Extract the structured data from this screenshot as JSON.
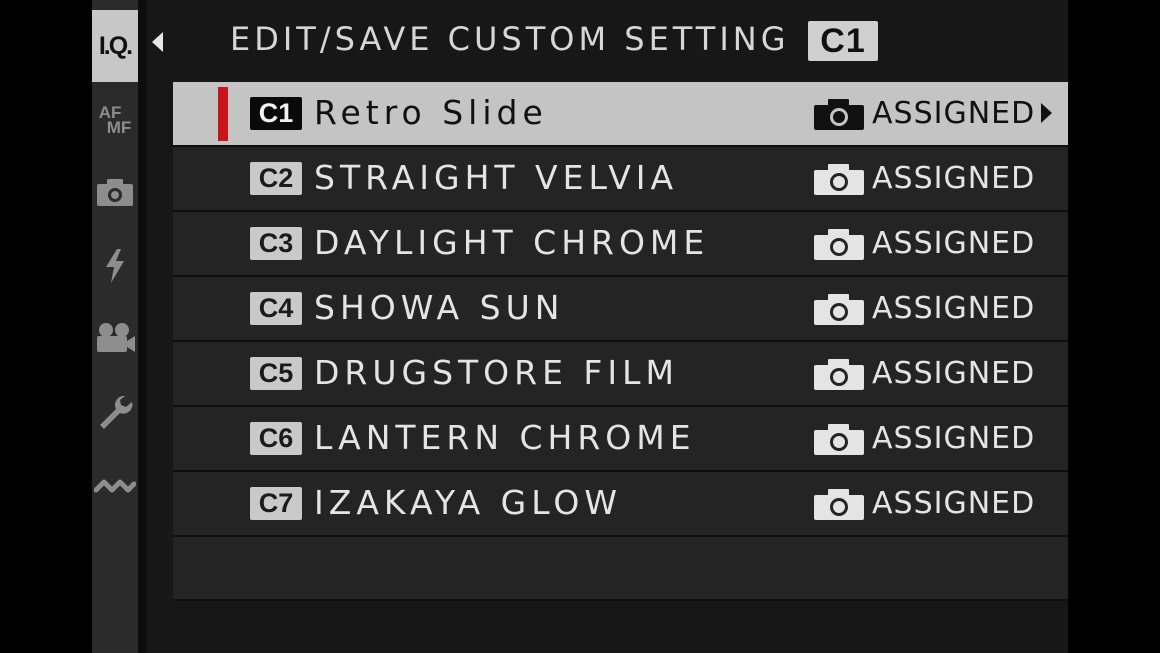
{
  "header": {
    "title": "EDIT/SAVE CUSTOM SETTING",
    "badge": "C1"
  },
  "sidebar": {
    "active_label": "I.Q.",
    "afmf_label_top": "AF",
    "afmf_label_bottom": "MF",
    "icons": [
      "iq-icon",
      "af-mf-icon",
      "camera-icon",
      "flash-icon",
      "movie-icon",
      "wrench-icon",
      "connection-icon"
    ]
  },
  "settings": [
    {
      "badge": "C1",
      "name": "Retro Slide",
      "status": "ASSIGNED",
      "selected": true
    },
    {
      "badge": "C2",
      "name": "STRAIGHT VELVIA",
      "status": "ASSIGNED",
      "selected": false
    },
    {
      "badge": "C3",
      "name": "DAYLIGHT CHROME",
      "status": "ASSIGNED",
      "selected": false
    },
    {
      "badge": "C4",
      "name": "SHOWA SUN",
      "status": "ASSIGNED",
      "selected": false
    },
    {
      "badge": "C5",
      "name": "DRUGSTORE FILM",
      "status": "ASSIGNED",
      "selected": false
    },
    {
      "badge": "C6",
      "name": "LANTERN CHROME",
      "status": "ASSIGNED",
      "selected": false
    },
    {
      "badge": "C7",
      "name": "IZAKAYA GLOW",
      "status": "ASSIGNED",
      "selected": false
    }
  ],
  "colors": {
    "background": "#171717",
    "row": "#242424",
    "selected_row": "#c4c4c4",
    "selection_marker": "#c8141b",
    "sidebar": "#2b2b2b"
  }
}
